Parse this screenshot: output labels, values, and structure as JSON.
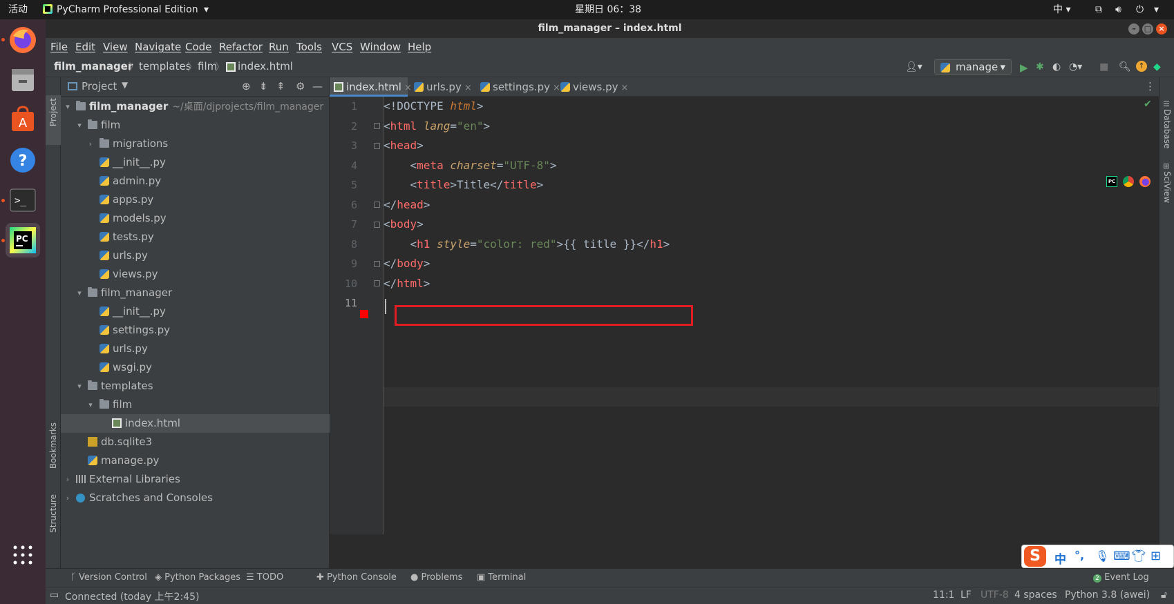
{
  "topbar": {
    "activities": "活动",
    "app_name": "PyCharm Professional Edition",
    "clock": "星期日 06：38",
    "input_method": "中"
  },
  "window": {
    "title": "film_manager – index.html"
  },
  "menu": [
    "File",
    "Edit",
    "View",
    "Navigate",
    "Code",
    "Refactor",
    "Run",
    "Tools",
    "VCS",
    "Window",
    "Help"
  ],
  "breadcrumb": [
    "film_manager",
    "templates",
    "film",
    "index.html"
  ],
  "run_config": "manage",
  "project_panel": {
    "title": "Project",
    "root_label": "film_manager",
    "root_path": "~/桌面/djprojects/film_manager",
    "items": [
      "film",
      "migrations",
      "__init__.py",
      "admin.py",
      "apps.py",
      "models.py",
      "tests.py",
      "urls.py",
      "views.py",
      "film_manager",
      "__init__.py",
      "settings.py",
      "urls.py",
      "wsgi.py",
      "templates",
      "film",
      "index.html",
      "db.sqlite3",
      "manage.py",
      "External Libraries",
      "Scratches and Consoles"
    ]
  },
  "left_strip": {
    "project": "Project",
    "bookmarks": "Bookmarks",
    "structure": "Structure"
  },
  "right_strip": {
    "database": "Database",
    "sciview": "SciView"
  },
  "tabs": [
    "index.html",
    "urls.py",
    "settings.py",
    "views.py"
  ],
  "editor": {
    "line_numbers": [
      "1",
      "2",
      "3",
      "4",
      "5",
      "6",
      "7",
      "8",
      "9",
      "10",
      "11"
    ]
  },
  "toolwindows": [
    "Version Control",
    "Python Packages",
    "TODO",
    "Python Console",
    "Problems",
    "Terminal"
  ],
  "event_log": "Event Log",
  "event_log_count": "2",
  "status": {
    "connected": "Connected (today 上午2:45)",
    "position": "11:1",
    "line_sep": "LF",
    "encoding": "UTF-8",
    "indent": "4 spaces",
    "interpreter": "Python 3.8 (awei)"
  },
  "ime": {
    "logo": "S",
    "lang": "中",
    "punct": "°,"
  },
  "colors": {
    "accent": "#4a88c7",
    "highlight_box": "#e31b23",
    "breakpoint": "#ff0000"
  }
}
